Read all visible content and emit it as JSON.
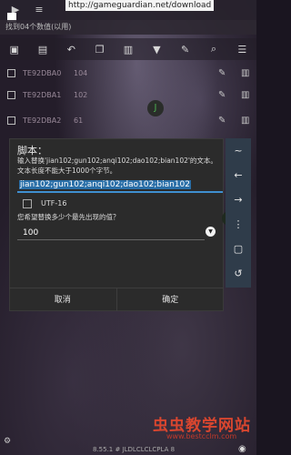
{
  "top_url": "http://gameguardian.net/download",
  "search_summary": "找到04个数值(以用)",
  "results": [
    {
      "address": "TE92DBA0",
      "value": "104"
    },
    {
      "address": "TE92DBA1",
      "value": "102"
    },
    {
      "address": "TE92DBA2",
      "value": "61"
    }
  ],
  "j_badge": "J",
  "dialog": {
    "title": "脚本：",
    "description": "输入替换'jian102;gun102;anqi102;dao102;bian102'的文本。文本长度不能大于1000个字节。",
    "script_value": "jian102;gun102;anqi102;dao102;bian102",
    "utf_label": "UTF-16",
    "count_label": "您希望替换多少个最先出现的值？",
    "count_value": "100",
    "cancel_label": "取消",
    "ok_label": "确定"
  },
  "side_panel": [
    "~",
    "←",
    "→",
    "⋮",
    "▢",
    "↺"
  ],
  "l_badge": "L",
  "watermark": "虫虫教学网站",
  "watermark_url": "www.bestcclm.com",
  "version": "8.55.1 # JLDLCLCLCPLA 8",
  "colors": {
    "accent": "#3f8fd0",
    "side_panel": "#2f3c4a",
    "watermark": "#d9462f"
  }
}
